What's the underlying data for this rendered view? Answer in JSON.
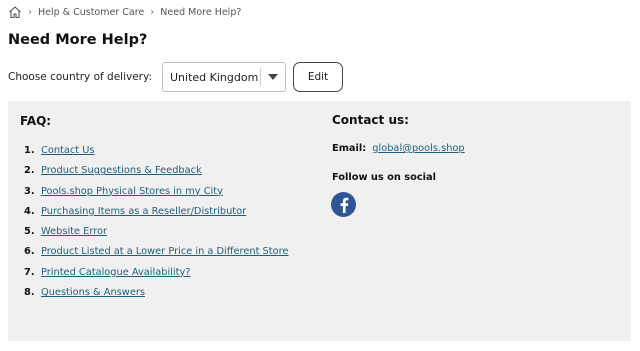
{
  "breadcrumb": {
    "home_icon": "home-icon",
    "items": [
      "Help & Customer Care",
      "Need More Help?"
    ]
  },
  "page": {
    "title": "Need More Help?"
  },
  "delivery": {
    "label": "Choose country of delivery:",
    "selected_country": "United Kingdom",
    "edit_label": "Edit"
  },
  "faq": {
    "heading": "FAQ:",
    "items": [
      {
        "num": "1.",
        "label": "Contact Us"
      },
      {
        "num": "2.",
        "label": "Product Suggestions & Feedback"
      },
      {
        "num": "3.",
        "label": "Pools.shop Physical Stores in my City"
      },
      {
        "num": "4.",
        "label": "Purchasing Items as a Reseller/Distributor"
      },
      {
        "num": "5.",
        "label": "Website Error"
      },
      {
        "num": "6.",
        "label": "Product Listed at a Lower Price in a Different Store"
      },
      {
        "num": "7.",
        "label": "Printed Catalogue Availability?"
      },
      {
        "num": "8.",
        "label": "Questions & Answers"
      }
    ]
  },
  "contact": {
    "heading": "Contact us:",
    "email_label": "Email:",
    "email": "global@pools.shop",
    "follow_label": "Follow us on social",
    "social_icon": "facebook-icon"
  },
  "colors": {
    "link": "#1f5f7a",
    "panel_bg": "#f0f0f0",
    "facebook": "#2f5597"
  }
}
